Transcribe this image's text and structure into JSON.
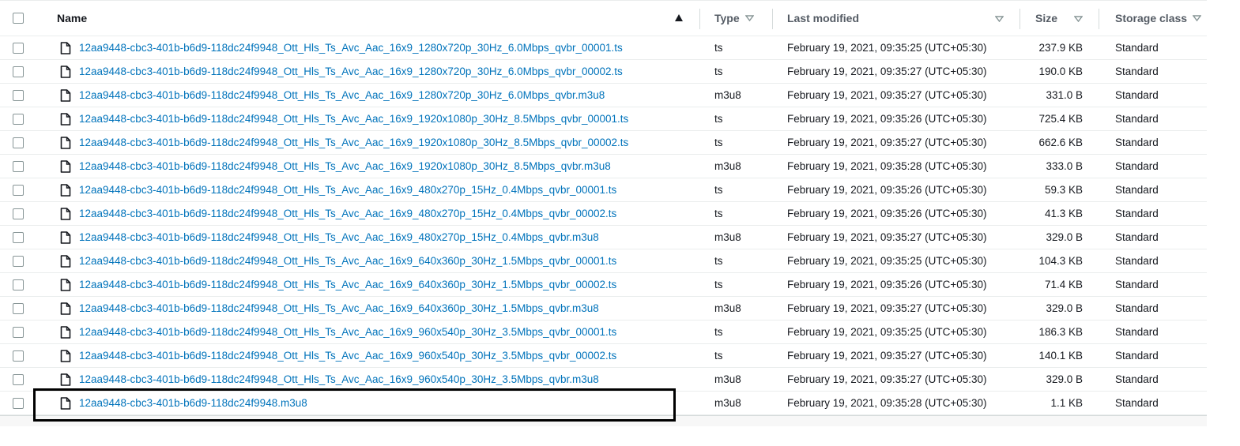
{
  "columns": {
    "name": "Name",
    "type": "Type",
    "last_modified": "Last modified",
    "size": "Size",
    "storage_class": "Storage class"
  },
  "rows": [
    {
      "name": "12aa9448-cbc3-401b-b6d9-118dc24f9948_Ott_Hls_Ts_Avc_Aac_16x9_1280x720p_30Hz_6.0Mbps_qvbr_00001.ts",
      "type": "ts",
      "modified": "February 19, 2021, 09:35:25 (UTC+05:30)",
      "size": "237.9 KB",
      "class": "Standard"
    },
    {
      "name": "12aa9448-cbc3-401b-b6d9-118dc24f9948_Ott_Hls_Ts_Avc_Aac_16x9_1280x720p_30Hz_6.0Mbps_qvbr_00002.ts",
      "type": "ts",
      "modified": "February 19, 2021, 09:35:27 (UTC+05:30)",
      "size": "190.0 KB",
      "class": "Standard"
    },
    {
      "name": "12aa9448-cbc3-401b-b6d9-118dc24f9948_Ott_Hls_Ts_Avc_Aac_16x9_1280x720p_30Hz_6.0Mbps_qvbr.m3u8",
      "type": "m3u8",
      "modified": "February 19, 2021, 09:35:27 (UTC+05:30)",
      "size": "331.0 B",
      "class": "Standard"
    },
    {
      "name": "12aa9448-cbc3-401b-b6d9-118dc24f9948_Ott_Hls_Ts_Avc_Aac_16x9_1920x1080p_30Hz_8.5Mbps_qvbr_00001.ts",
      "type": "ts",
      "modified": "February 19, 2021, 09:35:26 (UTC+05:30)",
      "size": "725.4 KB",
      "class": "Standard"
    },
    {
      "name": "12aa9448-cbc3-401b-b6d9-118dc24f9948_Ott_Hls_Ts_Avc_Aac_16x9_1920x1080p_30Hz_8.5Mbps_qvbr_00002.ts",
      "type": "ts",
      "modified": "February 19, 2021, 09:35:27 (UTC+05:30)",
      "size": "662.6 KB",
      "class": "Standard"
    },
    {
      "name": "12aa9448-cbc3-401b-b6d9-118dc24f9948_Ott_Hls_Ts_Avc_Aac_16x9_1920x1080p_30Hz_8.5Mbps_qvbr.m3u8",
      "type": "m3u8",
      "modified": "February 19, 2021, 09:35:28 (UTC+05:30)",
      "size": "333.0 B",
      "class": "Standard"
    },
    {
      "name": "12aa9448-cbc3-401b-b6d9-118dc24f9948_Ott_Hls_Ts_Avc_Aac_16x9_480x270p_15Hz_0.4Mbps_qvbr_00001.ts",
      "type": "ts",
      "modified": "February 19, 2021, 09:35:26 (UTC+05:30)",
      "size": "59.3 KB",
      "class": "Standard"
    },
    {
      "name": "12aa9448-cbc3-401b-b6d9-118dc24f9948_Ott_Hls_Ts_Avc_Aac_16x9_480x270p_15Hz_0.4Mbps_qvbr_00002.ts",
      "type": "ts",
      "modified": "February 19, 2021, 09:35:26 (UTC+05:30)",
      "size": "41.3 KB",
      "class": "Standard"
    },
    {
      "name": "12aa9448-cbc3-401b-b6d9-118dc24f9948_Ott_Hls_Ts_Avc_Aac_16x9_480x270p_15Hz_0.4Mbps_qvbr.m3u8",
      "type": "m3u8",
      "modified": "February 19, 2021, 09:35:27 (UTC+05:30)",
      "size": "329.0 B",
      "class": "Standard"
    },
    {
      "name": "12aa9448-cbc3-401b-b6d9-118dc24f9948_Ott_Hls_Ts_Avc_Aac_16x9_640x360p_30Hz_1.5Mbps_qvbr_00001.ts",
      "type": "ts",
      "modified": "February 19, 2021, 09:35:25 (UTC+05:30)",
      "size": "104.3 KB",
      "class": "Standard"
    },
    {
      "name": "12aa9448-cbc3-401b-b6d9-118dc24f9948_Ott_Hls_Ts_Avc_Aac_16x9_640x360p_30Hz_1.5Mbps_qvbr_00002.ts",
      "type": "ts",
      "modified": "February 19, 2021, 09:35:26 (UTC+05:30)",
      "size": "71.4 KB",
      "class": "Standard"
    },
    {
      "name": "12aa9448-cbc3-401b-b6d9-118dc24f9948_Ott_Hls_Ts_Avc_Aac_16x9_640x360p_30Hz_1.5Mbps_qvbr.m3u8",
      "type": "m3u8",
      "modified": "February 19, 2021, 09:35:27 (UTC+05:30)",
      "size": "329.0 B",
      "class": "Standard"
    },
    {
      "name": "12aa9448-cbc3-401b-b6d9-118dc24f9948_Ott_Hls_Ts_Avc_Aac_16x9_960x540p_30Hz_3.5Mbps_qvbr_00001.ts",
      "type": "ts",
      "modified": "February 19, 2021, 09:35:25 (UTC+05:30)",
      "size": "186.3 KB",
      "class": "Standard"
    },
    {
      "name": "12aa9448-cbc3-401b-b6d9-118dc24f9948_Ott_Hls_Ts_Avc_Aac_16x9_960x540p_30Hz_3.5Mbps_qvbr_00002.ts",
      "type": "ts",
      "modified": "February 19, 2021, 09:35:27 (UTC+05:30)",
      "size": "140.1 KB",
      "class": "Standard"
    },
    {
      "name": "12aa9448-cbc3-401b-b6d9-118dc24f9948_Ott_Hls_Ts_Avc_Aac_16x9_960x540p_30Hz_3.5Mbps_qvbr.m3u8",
      "type": "m3u8",
      "modified": "February 19, 2021, 09:35:27 (UTC+05:30)",
      "size": "329.0 B",
      "class": "Standard"
    },
    {
      "name": "12aa9448-cbc3-401b-b6d9-118dc24f9948.m3u8",
      "type": "m3u8",
      "modified": "February 19, 2021, 09:35:28 (UTC+05:30)",
      "size": "1.1 KB",
      "class": "Standard"
    }
  ],
  "colors": {
    "link": "#0073bb",
    "highlight_border": "#000000"
  }
}
